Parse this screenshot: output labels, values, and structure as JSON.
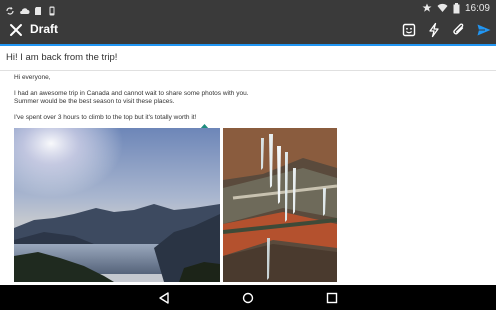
{
  "status_bar": {
    "time": "16:09",
    "notification_icons": [
      "sync-icon",
      "cloud-icon",
      "sd-card-icon",
      "phone-icon"
    ],
    "system_icons": [
      "star-icon",
      "wifi-icon",
      "battery-icon"
    ]
  },
  "toolbar": {
    "title": "Draft",
    "actions": [
      "close-icon",
      "emoji-icon",
      "flash-icon",
      "attach-icon",
      "send-icon"
    ],
    "accent_color": "#2196f3"
  },
  "subject": "Hi! I am back from the trip!",
  "body": {
    "greeting": "Hi everyone,",
    "line1": "I had an awesome trip in Canada and cannot wait to share some photos with you.",
    "line2": "Summer would be the best season to visit these places.",
    "line3": "I've spent over 3 hours to climb to the top but it's totally worth it!"
  },
  "attachments": [
    "lake-photo",
    "ice-cave-photo"
  ],
  "navigation": [
    "back-icon",
    "home-icon",
    "recents-icon"
  ]
}
